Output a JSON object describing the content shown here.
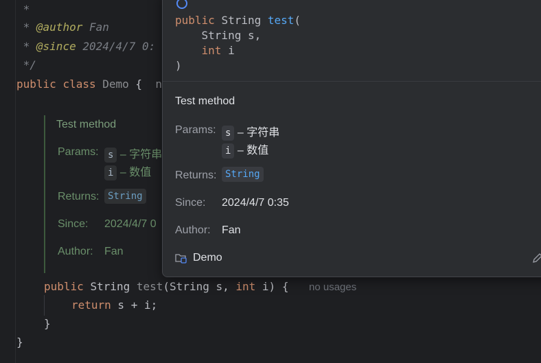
{
  "editor": {
    "comment_star": " *",
    "author_tag": "@author",
    "author_value": "Fan",
    "since_tag": "@since",
    "since_value": "2024/4/7 0:",
    "comment_end": " */",
    "class_kw1": "public",
    "class_kw2": "class",
    "class_name": "Demo",
    "class_brace": "{",
    "class_trailing": "n",
    "doc": {
      "description": "Test method",
      "params_label": "Params:",
      "param1_name": "s",
      "param1_desc": "– 字符串",
      "param2_name": "i",
      "param2_desc": "– 数值",
      "returns_label": "Returns:",
      "returns_type": "String",
      "since_label": "Since:",
      "since_value": "2024/4/7 0",
      "author_label": "Author:",
      "author_value": "Fan"
    },
    "method_public": "public",
    "method_type": "String",
    "method_name": "test",
    "method_paren_open": "(String s, ",
    "method_int": "int",
    "method_rest": " i) {",
    "usages_hint": "no usages",
    "return_kw": "return",
    "return_expr": " s + i;",
    "close_method": "}",
    "close_class": "}"
  },
  "popup": {
    "sig_public": "public",
    "sig_string": "String",
    "sig_name": "test",
    "sig_open": "(",
    "sig_param1": "    String s,",
    "sig_int": "int",
    "sig_param2": " i",
    "sig_close": ")",
    "description": "Test method",
    "params_label": "Params:",
    "param1_name": "s",
    "param1_desc": "– 字符串",
    "param2_name": "i",
    "param2_desc": "– 数值",
    "returns_label": "Returns:",
    "returns_type": "String",
    "since_label": "Since:",
    "since_value": "2024/4/7 0:35",
    "author_label": "Author:",
    "author_value": "Fan",
    "footer_class": "Demo"
  }
}
